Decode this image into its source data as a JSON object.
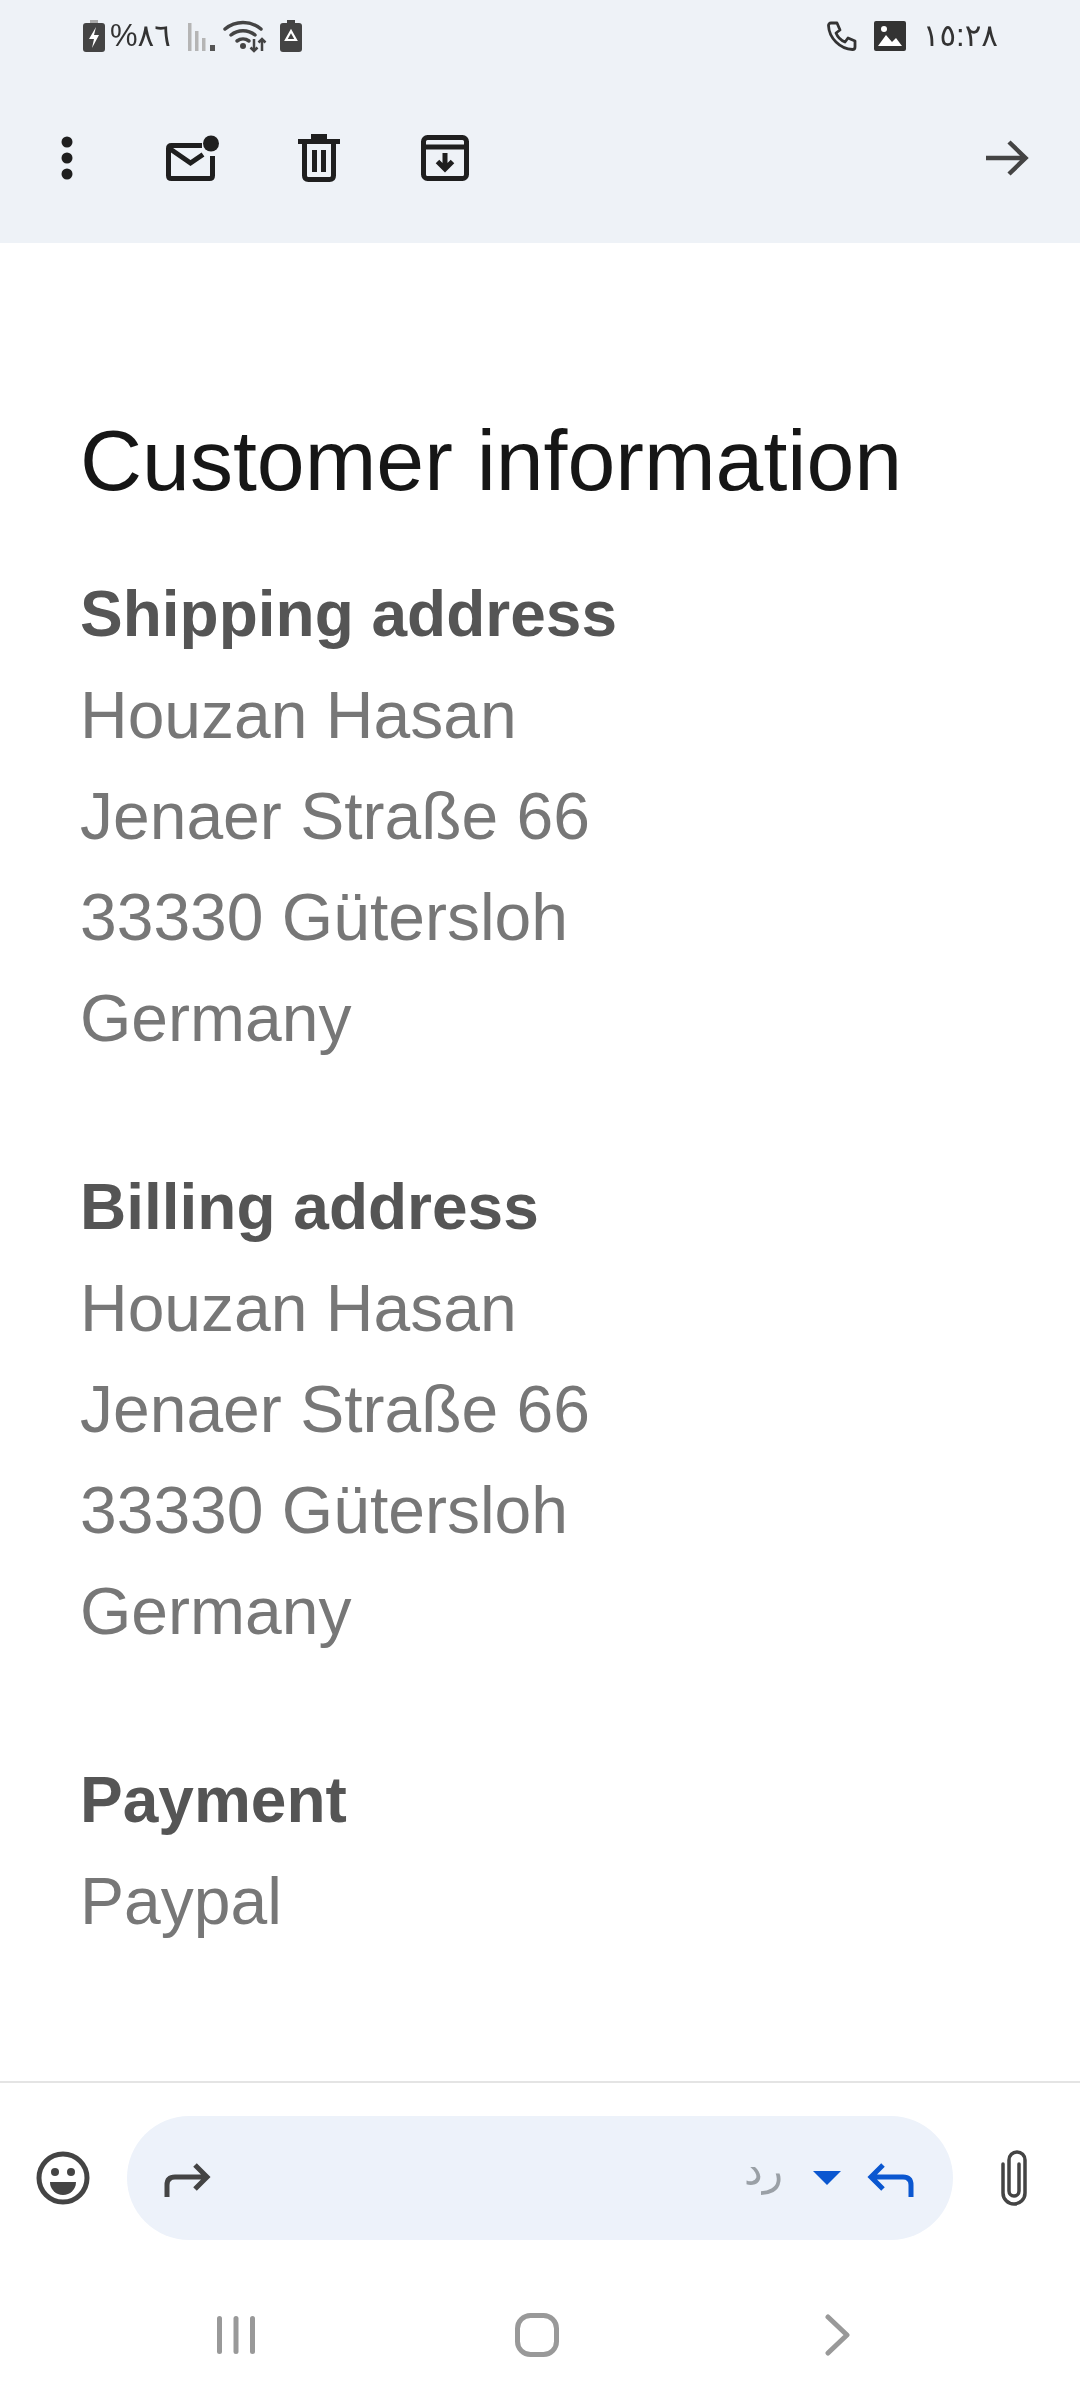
{
  "status_bar": {
    "battery": "%٨٦",
    "time": "١٥:٢٨"
  },
  "message": {
    "title": "Customer information",
    "sections": [
      {
        "heading": "Shipping address",
        "lines": [
          "Houzan Hasan",
          "Jenaer Straße 66",
          "33330 Gütersloh",
          "Germany"
        ]
      },
      {
        "heading": "Billing address",
        "lines": [
          "Houzan Hasan",
          "Jenaer Straße 66",
          "33330 Gütersloh",
          "Germany"
        ]
      },
      {
        "heading": "Payment",
        "lines": [
          "Paypal"
        ]
      }
    ]
  },
  "reply_bar": {
    "reply_label": "رد"
  }
}
